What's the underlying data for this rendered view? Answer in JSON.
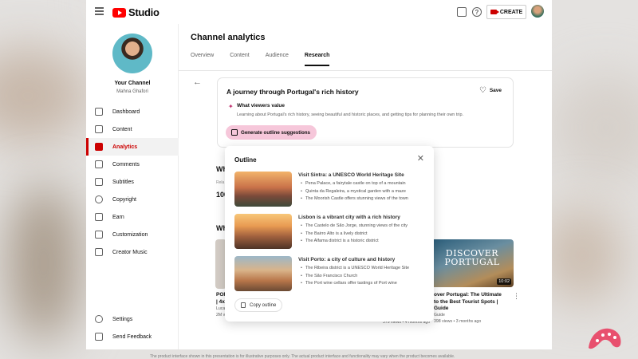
{
  "app": {
    "logo_text": "Studio",
    "create_label": "CREATE"
  },
  "channel": {
    "name": "Your Channel",
    "user": "Mahna Ghafori"
  },
  "sidebar": {
    "items": [
      {
        "label": "Dashboard",
        "icon": "dashboard-icon"
      },
      {
        "label": "Content",
        "icon": "content-icon"
      },
      {
        "label": "Analytics",
        "icon": "analytics-icon",
        "active": true
      },
      {
        "label": "Comments",
        "icon": "comments-icon"
      },
      {
        "label": "Subtitles",
        "icon": "subtitles-icon"
      },
      {
        "label": "Copyright",
        "icon": "copyright-icon"
      },
      {
        "label": "Earn",
        "icon": "earn-icon"
      },
      {
        "label": "Customization",
        "icon": "customization-icon"
      },
      {
        "label": "Creator Music",
        "icon": "music-icon"
      }
    ],
    "bottom": [
      {
        "label": "Settings",
        "icon": "gear-icon"
      },
      {
        "label": "Send Feedback",
        "icon": "feedback-icon"
      }
    ]
  },
  "page": {
    "title": "Channel analytics",
    "tabs": [
      "Overview",
      "Content",
      "Audience",
      "Research"
    ],
    "active_tab": "Research"
  },
  "research": {
    "title": "A journey through Portugal's rich history",
    "save_label": "Save",
    "viewers_value_label": "What viewers value",
    "viewers_value_desc": "Learning about Portugal's rich history, seeing beautiful and historic places, and getting tips for planning their own trip.",
    "generate_label": "Generate outline suggestions"
  },
  "background": {
    "heading1": "Wh",
    "small1": "Rela",
    "number1": "100",
    "heading2": "Wh",
    "left_video": {
      "title_line1": "POR",
      "title_line2": "| 4x",
      "meta1": "Luca",
      "meta2": "2M v"
    },
    "mid_video": {
      "meta": "379 views • 4 months ago"
    },
    "right_video": {
      "thumb_text_line1": "DISCOVER",
      "thumb_text_line2": "PORTUGAL",
      "duration": "10:02",
      "title_line1": "over Portugal: The Ultimate",
      "title_line2": "to the Best Tourist Spots |",
      "title_line3": "Guide",
      "meta1": "Guide",
      "meta2": "398 views • 3 months ago"
    }
  },
  "outline": {
    "title": "Outline",
    "items": [
      {
        "heading": "Visit Sintra: a UNESCO World Heritage Site",
        "bullets": [
          "Pena Palace, a fairytale castle on top of a mountain",
          "Quinta da Regaleira, a mystical garden with a maze",
          "The Moorish Castle offers stunning views of the town"
        ]
      },
      {
        "heading": "Lisbon is a vibrant city with a rich history",
        "bullets": [
          "The Castelo de São Jorge, stunning views of the city",
          "The Bairro Alto is a lively district",
          "The Alfama district is a historic district"
        ]
      },
      {
        "heading": "Visit Porto: a city of culture and history",
        "bullets": [
          "The Ribeira district is a UNESCO World Heritage Site",
          "The São Francisco Church",
          "The Port wine cellars offer tastings of Port wine"
        ]
      }
    ],
    "copy_label": "Copy outline"
  },
  "footer": {
    "text": "The product interface shown in this presentation is for illustrative purposes only. The actual product interface and functionality may vary when the product becomes available."
  }
}
